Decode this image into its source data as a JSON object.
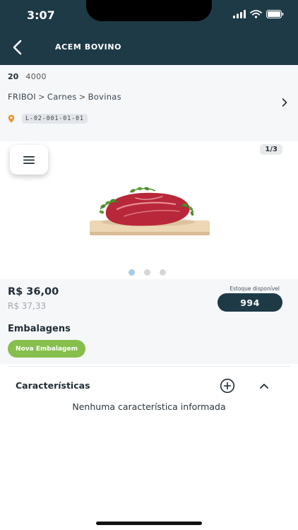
{
  "status_bar": {
    "time": "3:07"
  },
  "header": {
    "title": "ACEM BOVINO"
  },
  "product": {
    "code_primary": "20",
    "code_secondary": "4000",
    "breadcrumb": [
      "FRIBOI",
      "Carnes",
      "Bovinas"
    ],
    "breadcrumb_separator": ">",
    "location": "L-02-001-01-01"
  },
  "gallery": {
    "counter": "1/3",
    "total_images": 3,
    "active_index": 0
  },
  "pricing": {
    "price": "R$ 36,00",
    "old_price": "R$ 37,33",
    "stock_label": "Estoque disponível",
    "stock_value": "994"
  },
  "packaging": {
    "title": "Embalagens",
    "new_button": "Nova Embalagem"
  },
  "characteristics": {
    "title": "Características",
    "empty_message": "Nenhuma característica informada"
  },
  "colors": {
    "header_bg": "#1e3a46",
    "accent_green": "#86bf4c",
    "location_pin": "#f0922e",
    "dot_active": "#a5cbe6"
  },
  "icons": {
    "back": "chevron-left-icon",
    "detail": "chevron-right-icon",
    "location": "map-pin-icon",
    "menu": "hamburger-menu-icon",
    "add": "plus-circle-icon",
    "collapse": "chevron-up-icon"
  }
}
